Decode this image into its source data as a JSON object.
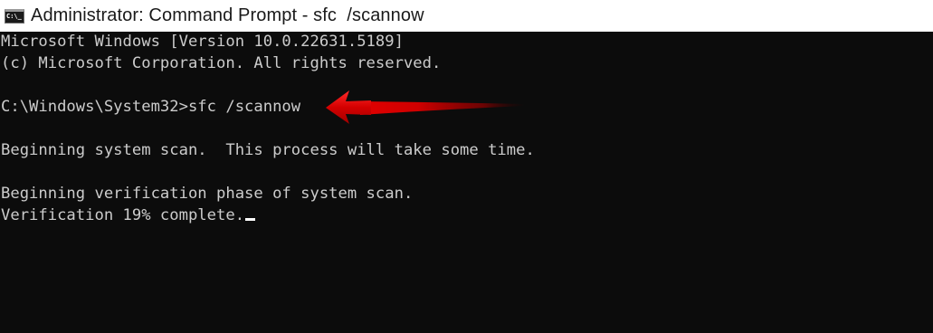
{
  "window": {
    "title": "Administrator: Command Prompt - sfc  /scannow",
    "icon_name": "command-prompt-icon",
    "icon_glyph": "C:\\_"
  },
  "console": {
    "lines": [
      "Microsoft Windows [Version 10.0.22631.5189]",
      "(c) Microsoft Corporation. All rights reserved.",
      "",
      "C:\\Windows\\System32>sfc /scannow",
      "",
      "Beginning system scan.  This process will take some time.",
      "",
      "Beginning verification phase of system scan.",
      "Verification 19% complete."
    ],
    "text_color": "#cccccc",
    "background": "#0c0c0c"
  },
  "annotation": {
    "icon_name": "red-arrow-icon",
    "color": "#d60000"
  }
}
